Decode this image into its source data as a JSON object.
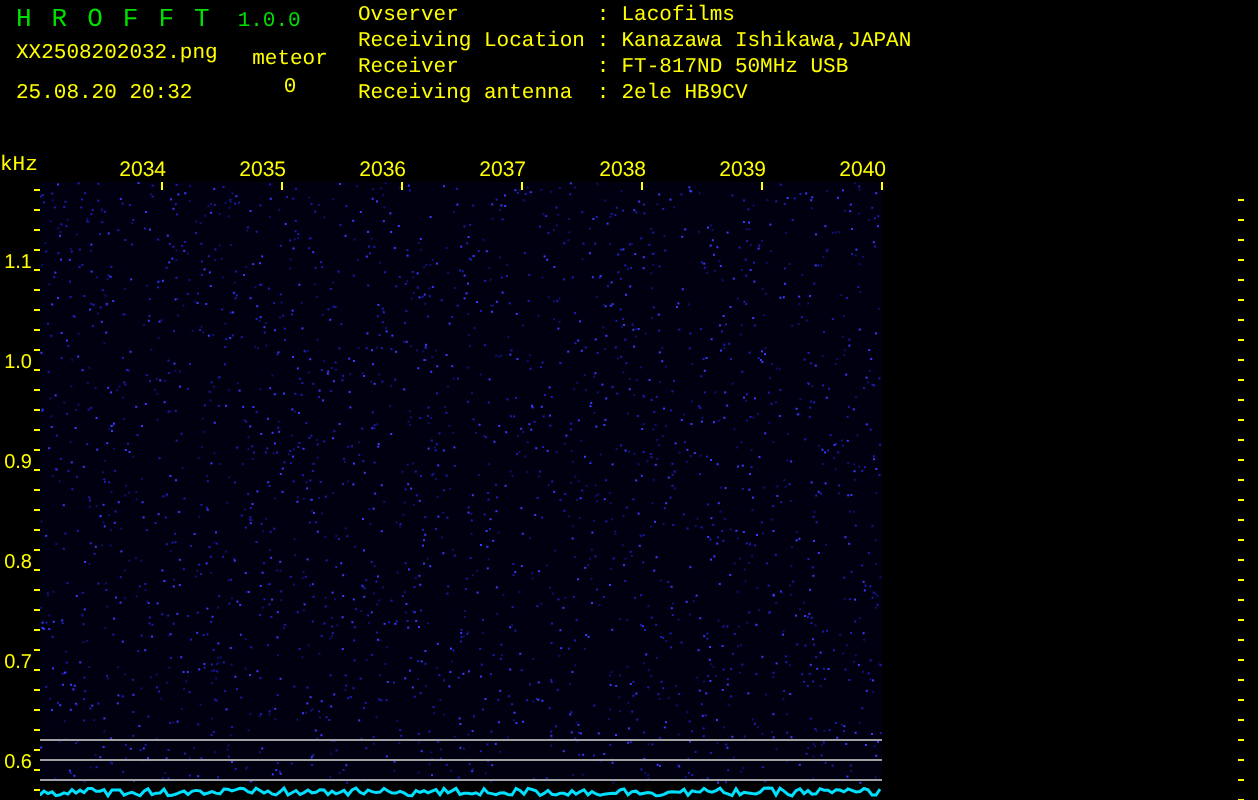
{
  "app": {
    "title": "HROFFT",
    "version": "1.0.0",
    "file": "XX2508202032.png",
    "datetime": "25.08.20 20:32"
  },
  "meteor": {
    "label": "meteor",
    "count": "0"
  },
  "info": [
    {
      "label": "Ovserver",
      "separator": ":",
      "value": "Lacofilms"
    },
    {
      "label": "Receiving Location",
      "separator": ":",
      "value": "Kanazawa Ishikawa,JAPAN"
    },
    {
      "label": "Receiver",
      "separator": ":",
      "value": "FT-817ND 50MHz USB"
    },
    {
      "label": "Receiving antenna",
      "separator": ":",
      "value": "2ele HB9CV"
    }
  ],
  "axis": {
    "unit": "kHz",
    "x_ticks": [
      "2034",
      "2035",
      "2036",
      "2037",
      "2038",
      "2039",
      "2040"
    ],
    "y_ticks": [
      "1.1",
      "1.0",
      "0.9",
      "0.8",
      "0.7",
      "0.6"
    ]
  }
}
